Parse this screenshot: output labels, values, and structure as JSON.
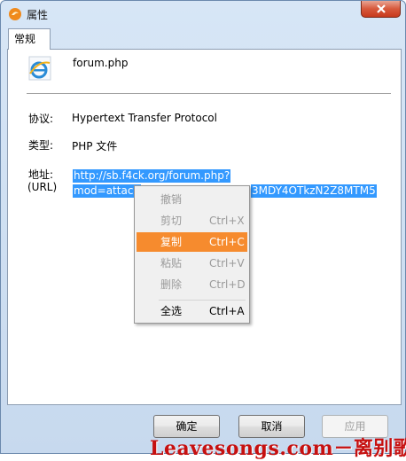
{
  "window": {
    "title": "属性"
  },
  "tabs": [
    {
      "label": "常规"
    }
  ],
  "file": {
    "name": "forum.php",
    "icon": "ie-file-icon"
  },
  "fields": [
    {
      "label": "协议:",
      "value": "Hypertext Transfer Protocol"
    },
    {
      "label": "类型:",
      "value": "PHP 文件"
    },
    {
      "label_line1": "地址:",
      "label_line2": "(URL)",
      "value_line1": "http://sb.f4ck.org/forum.php?",
      "value_line2_start": "mod=attach",
      "value_line2_end": "3MDY4OTkzN2Z8MTM5"
    }
  ],
  "context_menu": {
    "items": [
      {
        "label": "撤销",
        "shortcut": "",
        "state": "disabled"
      },
      {
        "label": "剪切",
        "shortcut": "Ctrl+X",
        "state": "disabled"
      },
      {
        "label": "复制",
        "shortcut": "Ctrl+C",
        "state": "highlighted"
      },
      {
        "label": "粘贴",
        "shortcut": "Ctrl+V",
        "state": "disabled"
      },
      {
        "label": "删除",
        "shortcut": "Ctrl+D",
        "state": "disabled"
      },
      {
        "label": "全选",
        "shortcut": "Ctrl+A",
        "state": "enabled"
      }
    ],
    "highlight_color": "#f68b2e"
  },
  "buttons": {
    "ok": "确定",
    "cancel": "取消",
    "apply": "应用"
  },
  "watermark": "Leavesongs.com－离别歌",
  "colors": {
    "selection": "#3399ff",
    "close_button": "#d7593c",
    "watermark": "#c61010"
  }
}
